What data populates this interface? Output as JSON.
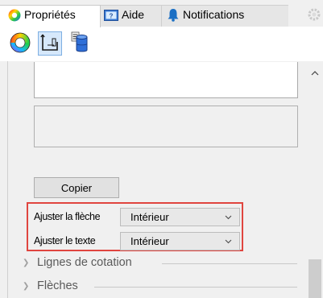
{
  "tabs": [
    {
      "label": "Propriétés",
      "active": true,
      "icon": "color-wheel-icon"
    },
    {
      "label": "Aide",
      "active": false,
      "icon": "help-screen-icon"
    },
    {
      "label": "Notifications",
      "active": false,
      "icon": "bell-icon"
    }
  ],
  "toolbar_icons": [
    "color-wheel-icon",
    "dimension-icon",
    "database-icon"
  ],
  "copy_button": {
    "label": "Copier"
  },
  "fields": [
    {
      "label": "Ajuster la flèche",
      "value": "Intérieur"
    },
    {
      "label": "Ajuster le texte",
      "value": "Intérieur"
    }
  ],
  "sections": [
    {
      "label": "Lignes de cotation"
    },
    {
      "label": "Flèches"
    }
  ],
  "colors": {
    "highlight": "#e0453f",
    "bell": "#1a6fc4",
    "selected": "#d6e8fb"
  }
}
